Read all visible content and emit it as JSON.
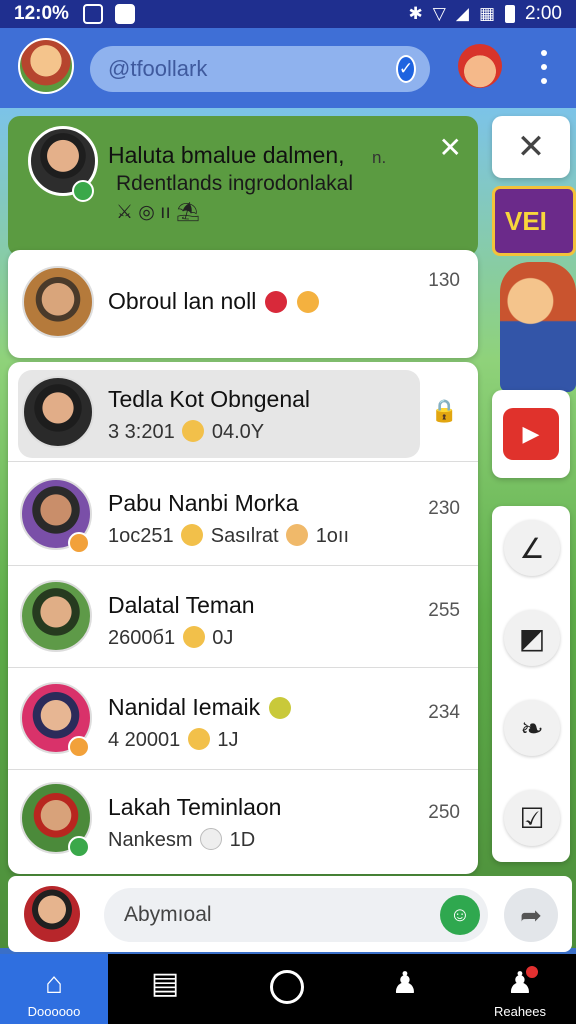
{
  "status_bar": {
    "time": "12:0%",
    "right_time": "2:00"
  },
  "app_bar": {
    "search_placeholder": "@tfoollark"
  },
  "notification": {
    "title": "Haluta bmalue dalmen,",
    "meta": "n.",
    "subtitle": "Rdentlands ingrodonlakal",
    "extra": "⚔ ◎ ıı ⛱"
  },
  "pinned_chat": {
    "name": "Obroul lan noll",
    "count": "130"
  },
  "chats": [
    {
      "name": "Tedla Kot Obngenal",
      "preview_a": "3 3:201",
      "preview_b": "04.0Y",
      "count": "",
      "selected": true
    },
    {
      "name": "Pabu Nanbi Morka",
      "preview_a": "1oc251",
      "preview_b": "Sasılrat",
      "preview_c": "1oıı",
      "count": "230"
    },
    {
      "name": "Dalatal Teman",
      "preview_a": "2600б1",
      "preview_b": "0J",
      "count": "255"
    },
    {
      "name": "Nanidal Iemaik",
      "preview_a": "4 20001",
      "preview_b": "1J",
      "count": "234"
    },
    {
      "name": "Lakah Teminlaon",
      "preview_a": "Nankesm",
      "preview_b": "1D",
      "count": "250"
    }
  ],
  "game": {
    "banner_text": "VEI"
  },
  "composer": {
    "placeholder": "Abymıoal"
  },
  "bottom_nav": {
    "home_label": "Doooooo",
    "right_label": "Reahees"
  },
  "colors": {
    "status_bar": "#1f2f8f",
    "app_bar": "#3f6fd6",
    "accent_blue": "#2f6fe0",
    "notification_green": "#5b9b41",
    "video_red": "#e0322c",
    "sticker_green": "#2fa84f"
  },
  "icons": {
    "close": "close-icon",
    "video": "video-icon",
    "send": "send-icon",
    "home": "home-icon",
    "profile": "profile-icon"
  }
}
